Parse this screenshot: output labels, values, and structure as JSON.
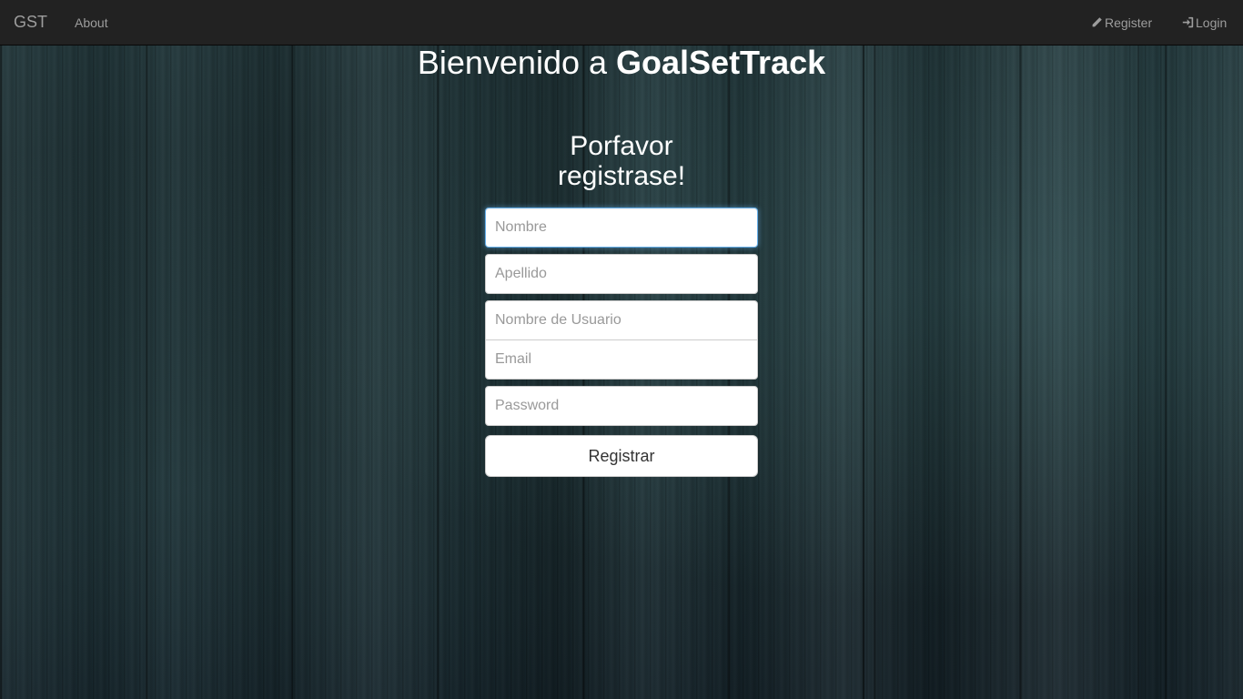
{
  "navbar": {
    "brand": "GST",
    "about": "About",
    "register": "Register",
    "login": "Login",
    "register_icon": "pencil-icon",
    "login_icon": "log-in-icon"
  },
  "hero": {
    "welcome_prefix": "Bienvenido a ",
    "welcome_app": "GoalSetTrack"
  },
  "form": {
    "title_line1": "Porfavor",
    "title_line2": "registrase!",
    "fields": {
      "nombre": {
        "placeholder": "Nombre",
        "value": ""
      },
      "apellido": {
        "placeholder": "Apellido",
        "value": ""
      },
      "usuario": {
        "placeholder": "Nombre de Usuario",
        "value": ""
      },
      "email": {
        "placeholder": "Email",
        "value": ""
      },
      "password": {
        "placeholder": "Password",
        "value": ""
      }
    },
    "submit_label": "Registrar"
  },
  "colors": {
    "navbar_bg": "#222222",
    "navbar_text": "#9d9d9d",
    "focus_border": "#66afe9"
  }
}
